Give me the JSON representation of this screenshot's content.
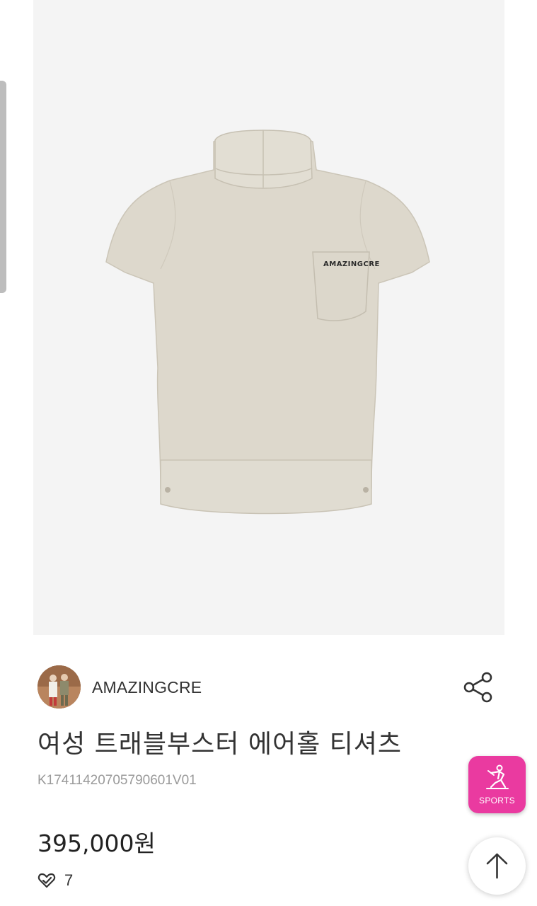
{
  "product": {
    "image_alt": "Women's high-neck short sleeve t-shirt in beige",
    "pocket_logo_text": "AMAZINGCRE",
    "brand_name": "AMAZINGCRE",
    "title": "여성 트래블부스터 에어홀 티셔츠",
    "code": "K17411420705790601V01",
    "price": "395,000원",
    "like_count": "7"
  },
  "floating": {
    "sports_label": "SPORTS"
  },
  "colors": {
    "sports_accent": "#ea3aa0",
    "image_background": "#f4f4f4",
    "shirt_color": "#ddd8cc"
  },
  "icons": {
    "share": "share-icon",
    "like": "heart-check-icon",
    "sports": "golfer-icon",
    "top": "arrow-up-icon"
  }
}
